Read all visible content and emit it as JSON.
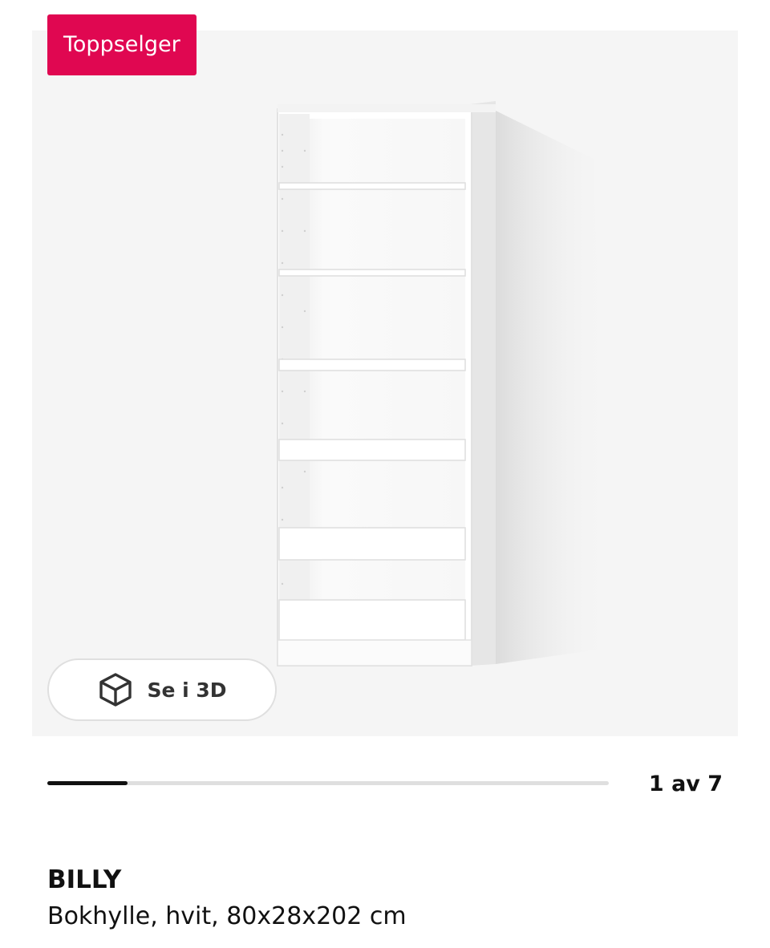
{
  "badge": {
    "label": "Toppselger",
    "color": "#e00751"
  },
  "hero": {
    "image_description_icon": "bookshelf-image",
    "view_3d": {
      "label": "Se i 3D",
      "icon": "cube-icon"
    }
  },
  "gallery": {
    "counter_text": "1 av 7",
    "progress_fraction": 0.143
  },
  "product": {
    "name": "BILLY",
    "description": "Bokhylle, hvit, 80x28x202 cm"
  }
}
